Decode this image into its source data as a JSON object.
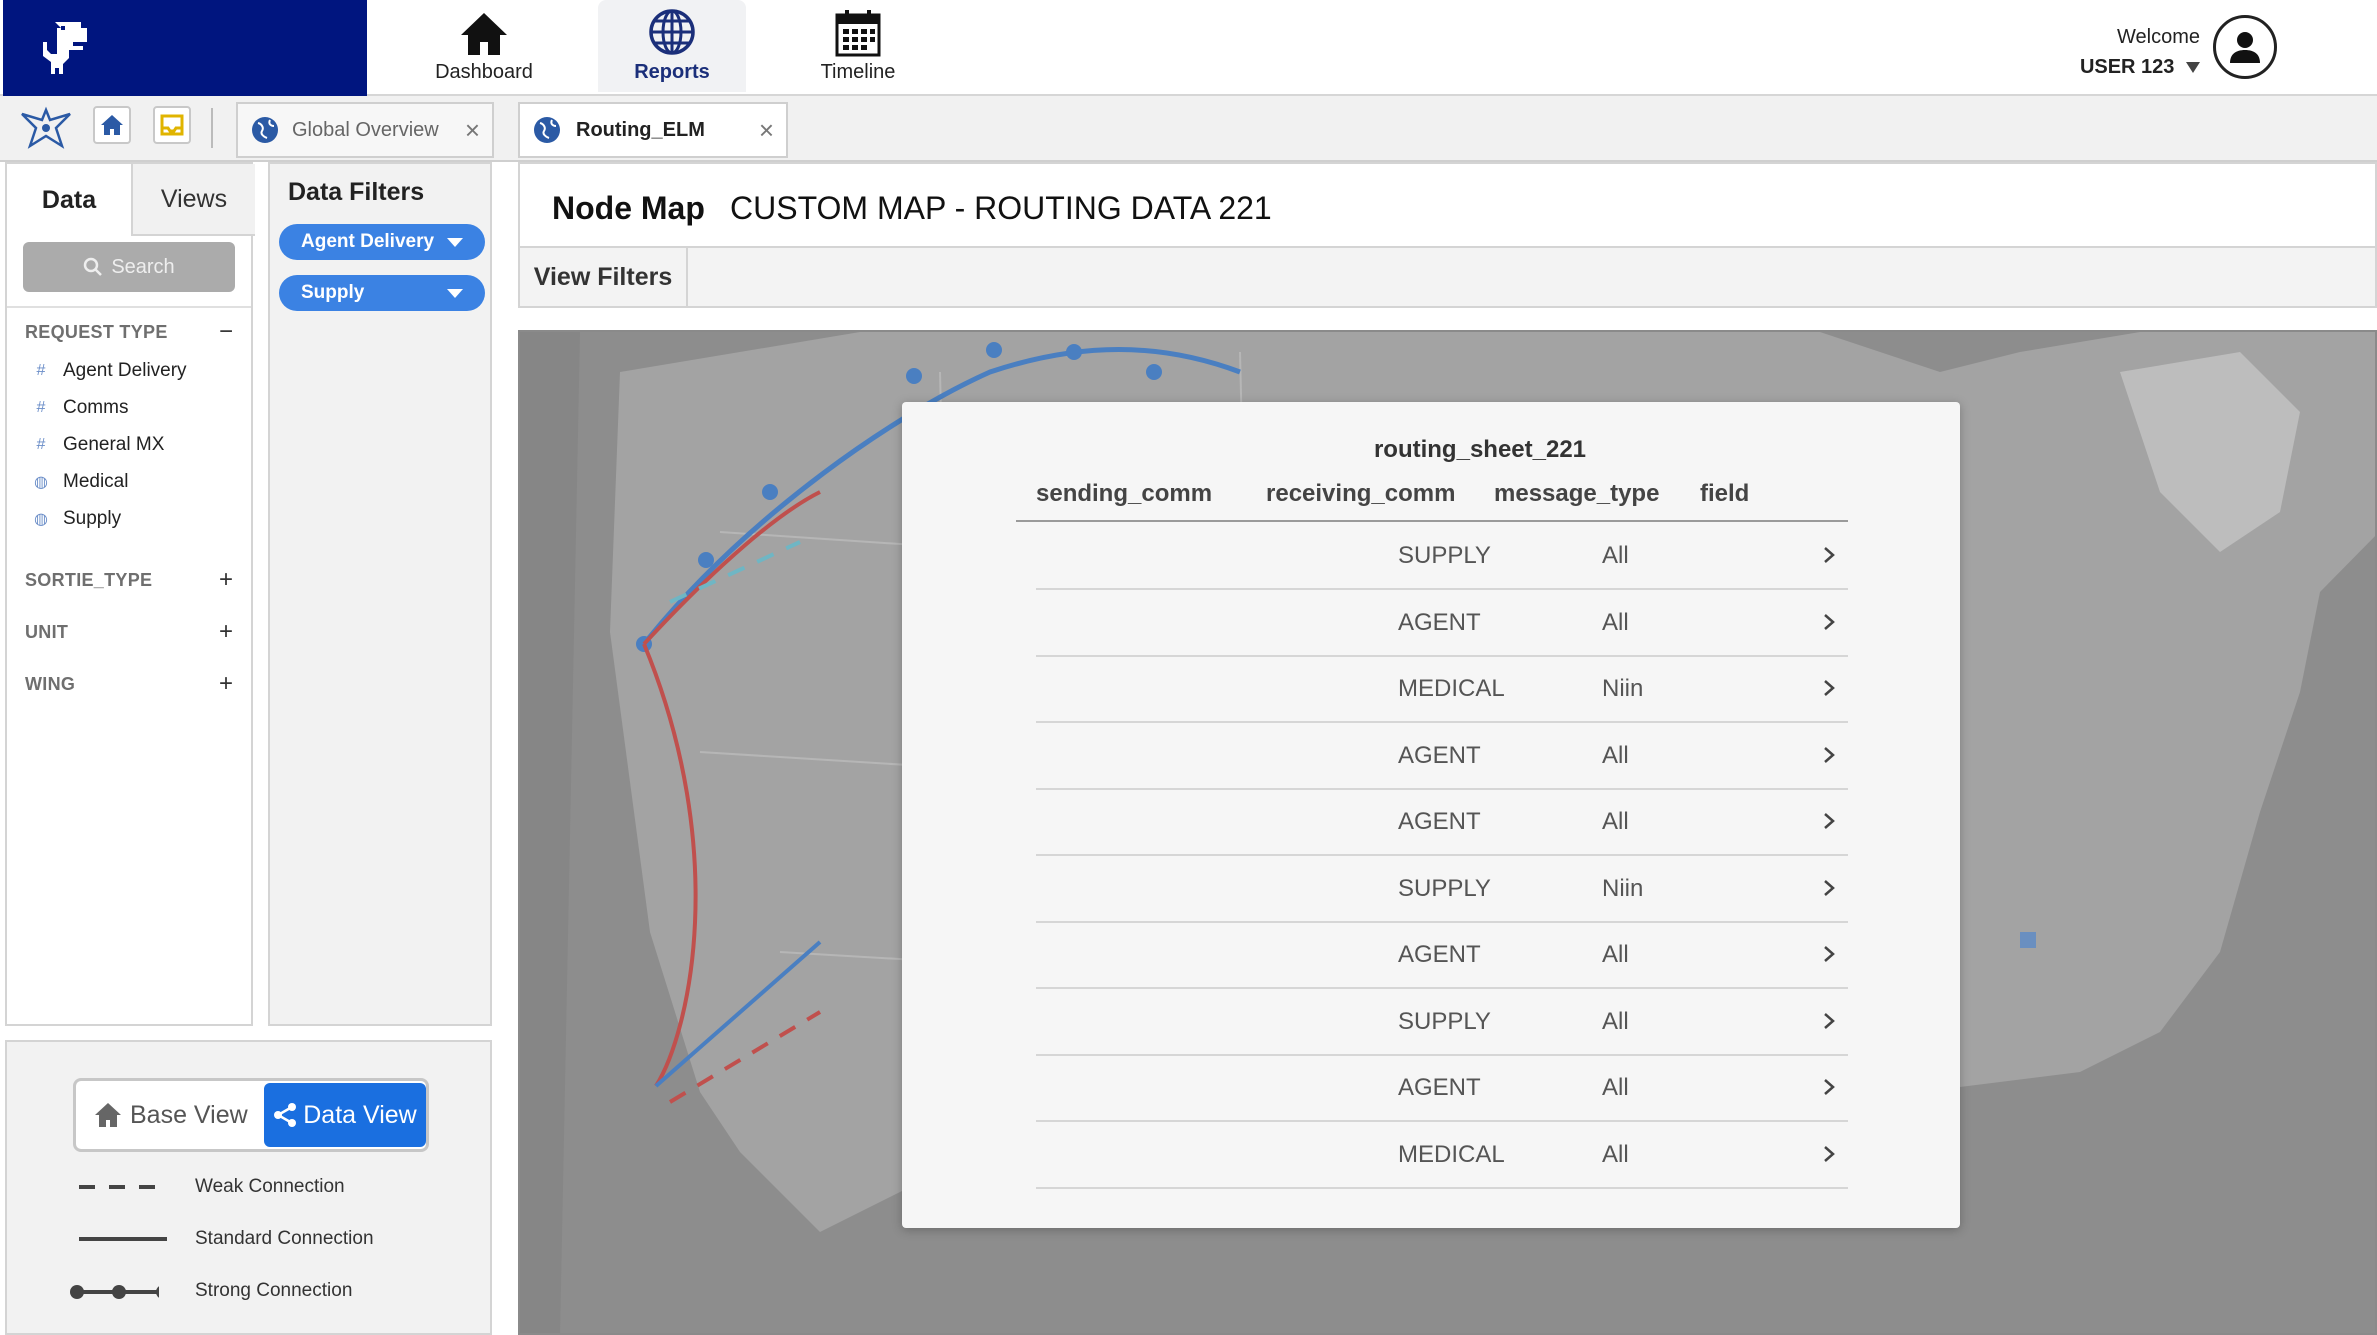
{
  "topnav": {
    "items": [
      {
        "label": "Dashboard",
        "icon": "home-icon"
      },
      {
        "label": "Reports",
        "icon": "globe-icon",
        "active": true
      },
      {
        "label": "Timeline",
        "icon": "calendar-icon"
      }
    ],
    "welcome": "Welcome",
    "user": "USER 123"
  },
  "tabs": [
    {
      "label": "Global Overview",
      "active": false
    },
    {
      "label": "Routing_ELM",
      "active": true
    }
  ],
  "left_panel": {
    "tab_data": "Data",
    "tab_views": "Views",
    "search_label": "Search",
    "sections": [
      {
        "title": "REQUEST TYPE",
        "ctrl": "−",
        "items": [
          {
            "label": "Agent Delivery",
            "icon": "hash-icon"
          },
          {
            "label": "Comms",
            "icon": "hash-icon"
          },
          {
            "label": "General MX",
            "icon": "hash-icon"
          },
          {
            "label": "Medical",
            "icon": "globe-icon"
          },
          {
            "label": "Supply",
            "icon": "globe-icon"
          }
        ]
      },
      {
        "title": "SORTIE_TYPE",
        "ctrl": "+"
      },
      {
        "title": "UNIT",
        "ctrl": "+"
      },
      {
        "title": "WING",
        "ctrl": "+"
      }
    ]
  },
  "filters": {
    "title": "Data Filters",
    "chips": [
      "Agent Delivery",
      "Supply"
    ]
  },
  "legend": {
    "base_view": "Base View",
    "data_view": "Data View",
    "items": [
      "Weak Connection",
      "Standard Connection",
      "Strong Connection"
    ]
  },
  "main": {
    "header_label": "Node Map",
    "map_title": "CUSTOM MAP - ROUTING DATA 221",
    "view_filters": "View Filters"
  },
  "modal": {
    "sheet_name": "routing_sheet_221",
    "columns": [
      "sending_comm",
      "receiving_comm",
      "message_type",
      "field"
    ],
    "rows": [
      {
        "message_type": "SUPPLY",
        "field": "All"
      },
      {
        "message_type": "AGENT",
        "field": "All"
      },
      {
        "message_type": "MEDICAL",
        "field": "Niin"
      },
      {
        "message_type": "AGENT",
        "field": "All"
      },
      {
        "message_type": "AGENT",
        "field": "All"
      },
      {
        "message_type": "SUPPLY",
        "field": "Niin"
      },
      {
        "message_type": "AGENT",
        "field": "All"
      },
      {
        "message_type": "SUPPLY",
        "field": "All"
      },
      {
        "message_type": "AGENT",
        "field": "All"
      },
      {
        "message_type": "MEDICAL",
        "field": "All"
      }
    ]
  },
  "colors": {
    "brand_navy": "#00157f",
    "accent_blue": "#1a6fe0",
    "chip_blue": "#3b82e3",
    "route_blue": "#4a7fc1",
    "route_red": "#c0504d"
  }
}
